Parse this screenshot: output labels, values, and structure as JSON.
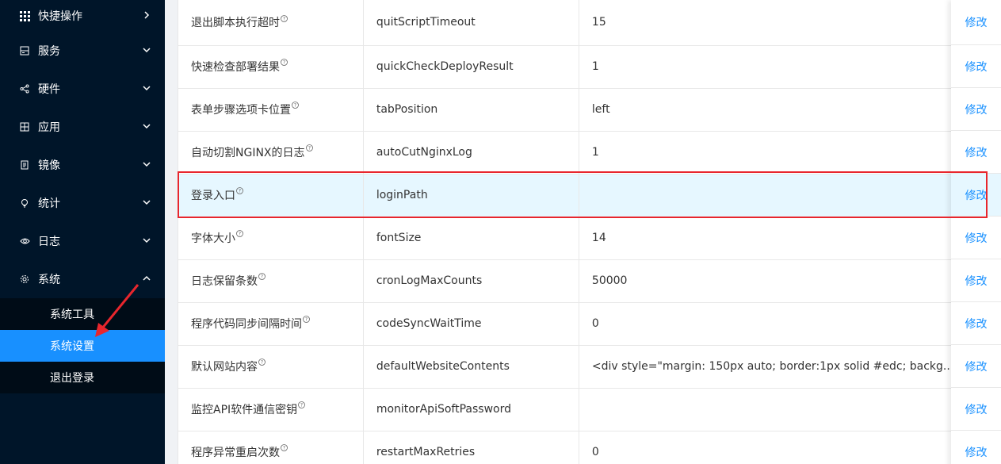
{
  "sidebar": {
    "items": [
      {
        "label": "快捷操作",
        "icon": "grid-icon",
        "chevron": "chevron-right"
      },
      {
        "label": "服务",
        "icon": "server-icon",
        "chevron": "chevron-down"
      },
      {
        "label": "硬件",
        "icon": "share-icon",
        "chevron": "chevron-down"
      },
      {
        "label": "应用",
        "icon": "apps-icon",
        "chevron": "chevron-down"
      },
      {
        "label": "镜像",
        "icon": "image-doc-icon",
        "chevron": "chevron-down"
      },
      {
        "label": "统计",
        "icon": "bulb-icon",
        "chevron": "chevron-down"
      },
      {
        "label": "日志",
        "icon": "eye-icon",
        "chevron": "chevron-down"
      },
      {
        "label": "系统",
        "icon": "gear-icon",
        "chevron": "chevron-up"
      }
    ],
    "submenu": [
      {
        "label": "系统工具"
      },
      {
        "label": "系统设置"
      },
      {
        "label": "退出登录"
      }
    ]
  },
  "table": {
    "help_glyph": "?",
    "action_label": "修改",
    "rows": [
      {
        "name": "退出脚本执行超时",
        "key": "quitScriptTimeout",
        "value": "15"
      },
      {
        "name": "快速检查部署结果",
        "key": "quickCheckDeployResult",
        "value": "1"
      },
      {
        "name": "表单步骤选项卡位置",
        "key": "tabPosition",
        "value": "left"
      },
      {
        "name": "自动切割NGINX的日志",
        "key": "autoCutNginxLog",
        "value": "1"
      },
      {
        "name": "登录入口",
        "key": "loginPath",
        "value": ""
      },
      {
        "name": "字体大小",
        "key": "fontSize",
        "value": "14"
      },
      {
        "name": "日志保留条数",
        "key": "cronLogMaxCounts",
        "value": "50000"
      },
      {
        "name": "程序代码同步间隔时间",
        "key": "codeSyncWaitTime",
        "value": "0"
      },
      {
        "name": "默认网站内容",
        "key": "defaultWebsiteContents",
        "value": "<div style=\"margin: 150px auto; border:1px solid #edc; backg..."
      },
      {
        "name": "监控API软件通信密钥",
        "key": "monitorApiSoftPassword",
        "value": ""
      },
      {
        "name": "程序异常重启次数",
        "key": "restartMaxRetries",
        "value": "0"
      }
    ]
  },
  "colors": {
    "sidebar_bg": "#001529",
    "submenu_bg": "#000c17",
    "active": "#1890ff",
    "link": "#1890ff",
    "highlight_row": "#e6f7ff",
    "annotation_red": "#e8262d"
  }
}
